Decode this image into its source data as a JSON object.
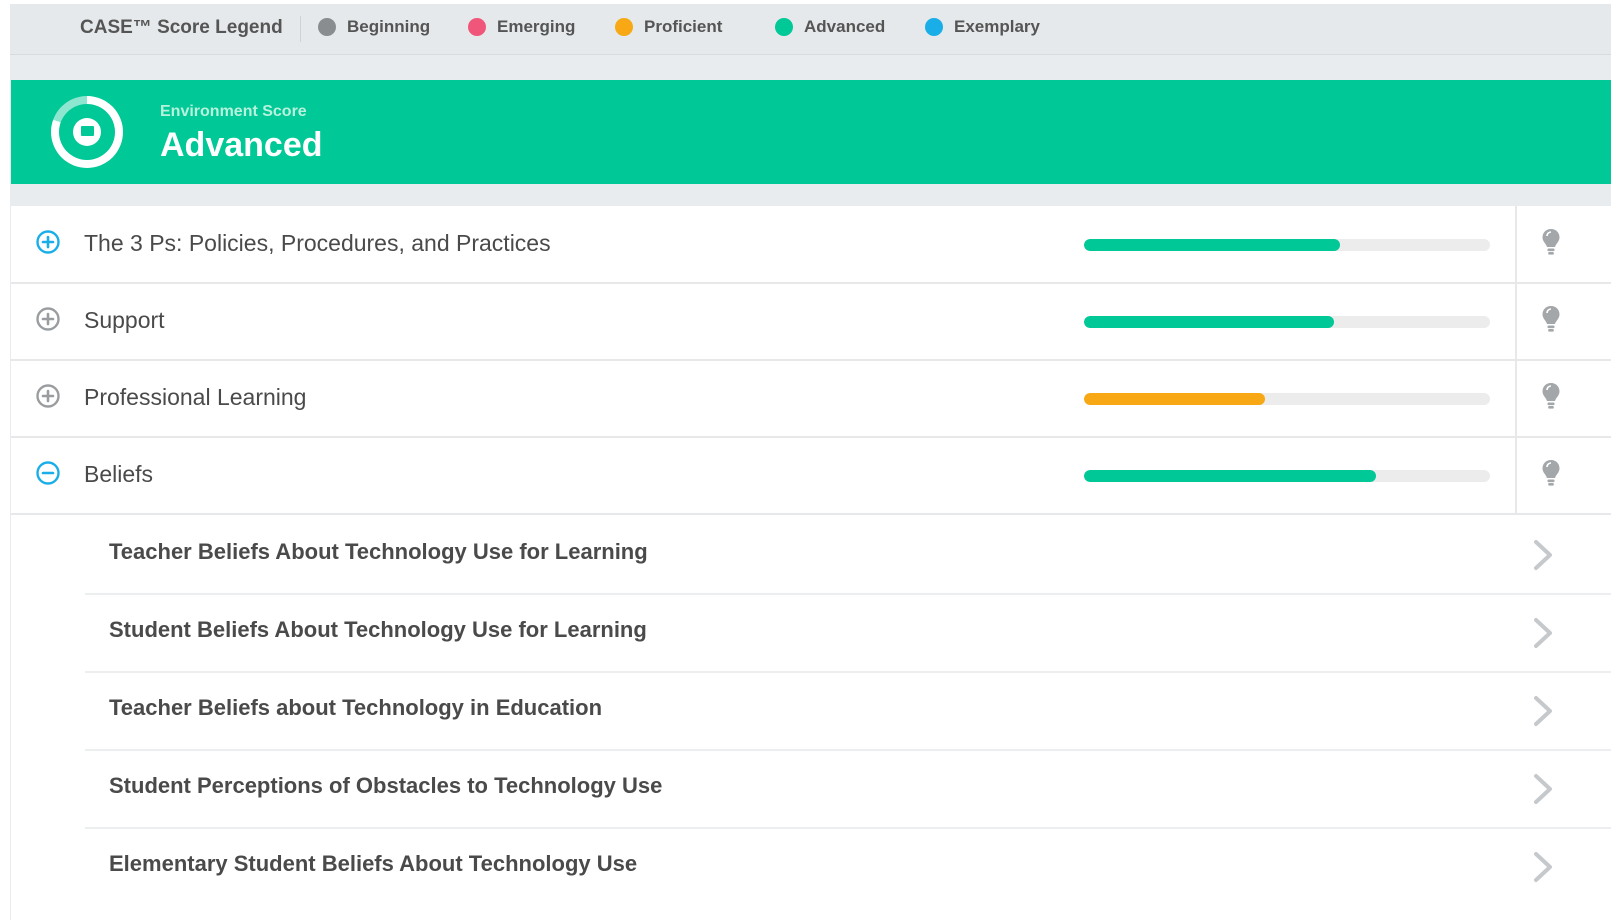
{
  "legend": {
    "title": "CASE™ Score Legend",
    "items": [
      {
        "label": "Beginning",
        "color": "#8a8d90"
      },
      {
        "label": "Emerging",
        "color": "#f0567a"
      },
      {
        "label": "Proficient",
        "color": "#f7a814"
      },
      {
        "label": "Advanced",
        "color": "#00c896"
      },
      {
        "label": "Exemplary",
        "color": "#1aaee8"
      }
    ]
  },
  "banner": {
    "subtitle": "Environment Score",
    "score": "Advanced",
    "color": "#00c896"
  },
  "categories": [
    {
      "label": "The 3 Ps: Policies, Procedures, and Practices",
      "state": "collapsed",
      "toggle_color": "#1aaee8",
      "progress": 0.63,
      "bar_color": "#00c896"
    },
    {
      "label": "Support",
      "state": "collapsed",
      "toggle_color": "#9a9da0",
      "progress": 0.615,
      "bar_color": "#00c896"
    },
    {
      "label": "Professional Learning",
      "state": "collapsed",
      "toggle_color": "#9a9da0",
      "progress": 0.445,
      "bar_color": "#f7a814"
    },
    {
      "label": "Beliefs",
      "state": "expanded",
      "toggle_color": "#1aaee8",
      "progress": 0.72,
      "bar_color": "#00c896"
    }
  ],
  "subitems": [
    {
      "label": "Teacher Beliefs About Technology Use for Learning"
    },
    {
      "label": "Student Beliefs About Technology Use for Learning"
    },
    {
      "label": "Teacher Beliefs about Technology in Education"
    },
    {
      "label": "Student Perceptions of Obstacles to Technology Use"
    },
    {
      "label": "Elementary Student Beliefs About Technology Use"
    }
  ],
  "icons": {
    "expand": "plus-circle-icon",
    "collapse": "minus-circle-icon",
    "tip": "lightbulb-icon",
    "navigate": "chevron-right-icon",
    "score": "score-ring-icon"
  }
}
